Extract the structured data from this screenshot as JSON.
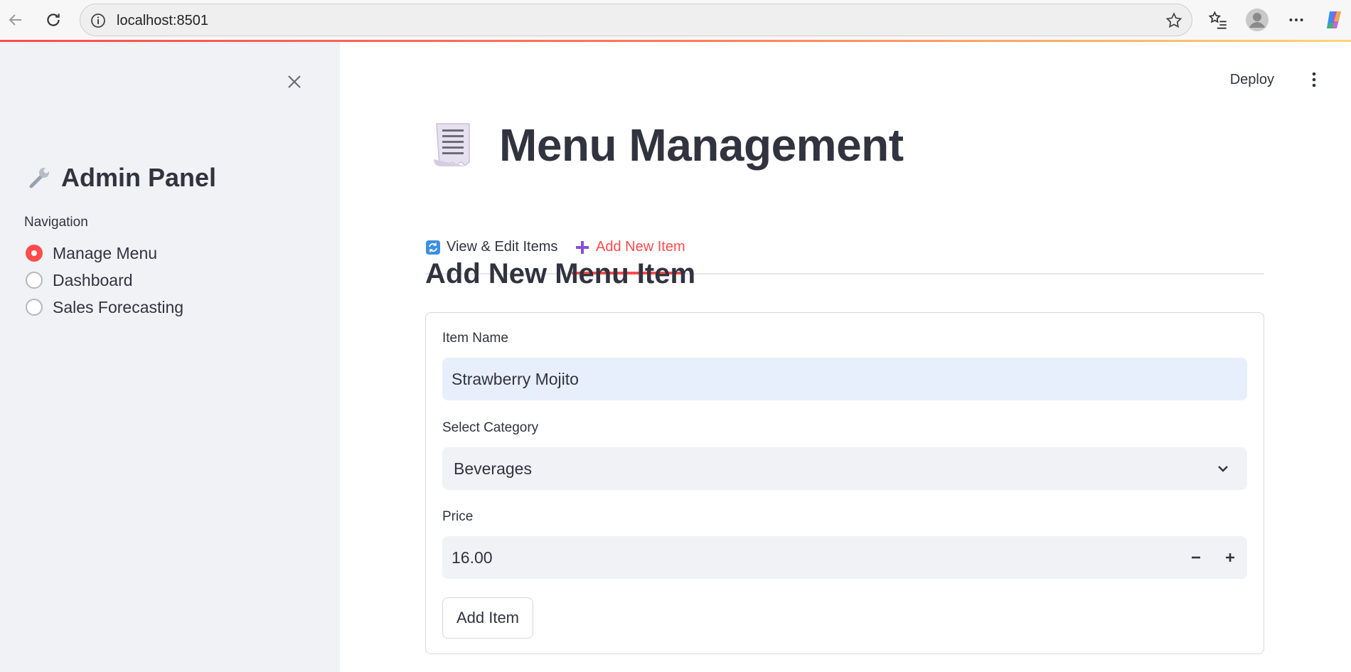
{
  "browser": {
    "url": "localhost:8501"
  },
  "sidebar": {
    "title_icon": "wrench-icon",
    "title": "Admin Panel",
    "nav_label": "Navigation",
    "items": [
      {
        "label": "Manage Menu",
        "selected": true
      },
      {
        "label": "Dashboard",
        "selected": false
      },
      {
        "label": "Sales Forecasting",
        "selected": false
      }
    ]
  },
  "header": {
    "deploy_label": "Deploy"
  },
  "main": {
    "title_icon": "receipt-icon",
    "title": "Menu Management",
    "tabs": [
      {
        "label": "View & Edit Items",
        "icon": "refresh-icon",
        "active": false
      },
      {
        "label": "Add New Item",
        "icon": "plus-icon",
        "active": true
      }
    ],
    "section_title": "Add New Menu Item",
    "form": {
      "item_name_label": "Item Name",
      "item_name_value": "Strawberry Mojito",
      "category_label": "Select Category",
      "category_value": "Beverages",
      "price_label": "Price",
      "price_value": "16.00",
      "submit_label": "Add Item"
    }
  },
  "colors": {
    "accent": "#ff4b4b",
    "sidebar_bg": "#f0f2f6",
    "text": "#31333f",
    "input_focus_bg": "#e8effc"
  }
}
